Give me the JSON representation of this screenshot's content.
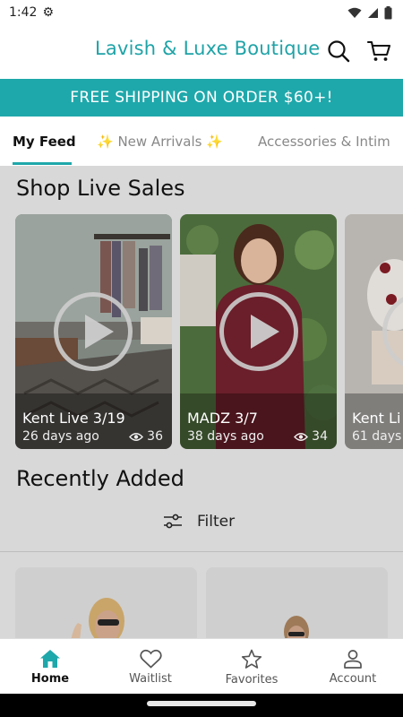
{
  "status_bar": {
    "time": "1:42",
    "icons": [
      "gear-icon",
      "wifi-icon",
      "signal-icon",
      "battery-icon"
    ]
  },
  "header": {
    "title": "Lavish & Luxe Boutique",
    "icons": [
      "search-icon",
      "cart-icon"
    ]
  },
  "promo": {
    "text": "FREE SHIPPING ON ORDER $60+!"
  },
  "tabs": [
    {
      "label": "My Feed",
      "active": true
    },
    {
      "label": "✨ New Arrivals ✨",
      "active": false
    },
    {
      "label": "Accessories & Intim",
      "active": false
    }
  ],
  "live_section": {
    "title": "Shop Live Sales",
    "cards": [
      {
        "title": "Kent Live 3/19",
        "age": "26 days ago",
        "views": "36"
      },
      {
        "title": "MADZ 3/7",
        "age": "38 days ago",
        "views": "34"
      },
      {
        "title": "Kent Li",
        "age": "61 days",
        "views": ""
      }
    ]
  },
  "recent_section": {
    "title": "Recently Added",
    "filter_label": "Filter"
  },
  "bottom_nav": [
    {
      "label": "Home",
      "icon": "home-icon",
      "active": true
    },
    {
      "label": "Waitlist",
      "icon": "heart-icon",
      "active": false
    },
    {
      "label": "Favorites",
      "icon": "star-icon",
      "active": false
    },
    {
      "label": "Account",
      "icon": "person-icon",
      "active": false
    }
  ],
  "colors": {
    "accent": "#1fa8ab",
    "title": "#1fa3a7",
    "overlay": "#d8d8d8"
  }
}
